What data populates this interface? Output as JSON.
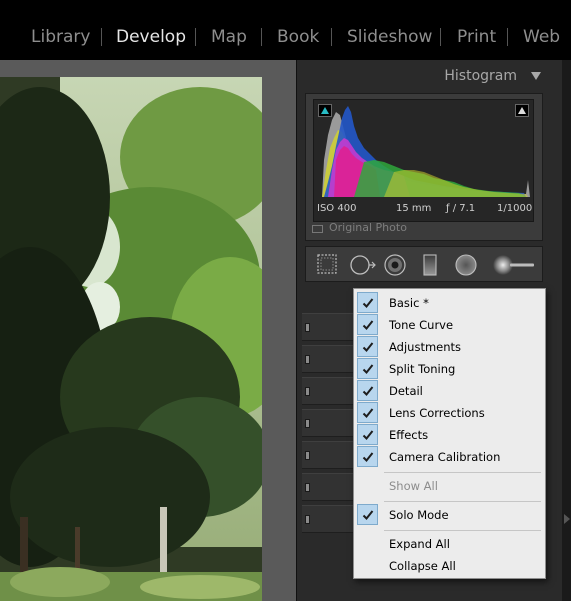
{
  "module_picker": {
    "modules": [
      {
        "label": "Library",
        "active": false
      },
      {
        "label": "Develop",
        "active": true
      },
      {
        "label": "Map",
        "active": false
      },
      {
        "label": "Book",
        "active": false
      },
      {
        "label": "Slideshow",
        "active": false
      },
      {
        "label": "Print",
        "active": false
      },
      {
        "label": "Web",
        "active": false
      }
    ]
  },
  "histogram": {
    "title": "Histogram",
    "exif": {
      "iso": "ISO 400",
      "focal_length": "15 mm",
      "aperture": "ƒ / 7.1",
      "shutter": "1/1000"
    },
    "original_photo_label": "Original Photo",
    "colors": {
      "shadow_clip": "#28bcc5",
      "highlight_clip": "#dddddd"
    }
  },
  "tool_strip": {
    "tools": [
      {
        "icon": "crop-overlay-icon"
      },
      {
        "icon": "spot-removal-icon"
      },
      {
        "icon": "red-eye-correction-icon"
      },
      {
        "icon": "graduated-filter-icon"
      },
      {
        "icon": "radial-filter-icon"
      },
      {
        "icon": "adjustment-brush-icon"
      }
    ]
  },
  "panel_menu": {
    "panels": [
      {
        "label": "Basic *",
        "checked": true
      },
      {
        "label": "Tone Curve",
        "checked": true
      },
      {
        "label": "Adjustments",
        "checked": true
      },
      {
        "label": "Split Toning",
        "checked": true
      },
      {
        "label": "Detail",
        "checked": true
      },
      {
        "label": "Lens Corrections",
        "checked": true
      },
      {
        "label": "Effects",
        "checked": true
      },
      {
        "label": "Camera Calibration",
        "checked": true
      }
    ],
    "show_all": {
      "label": "Show All",
      "enabled": false
    },
    "solo_mode": {
      "label": "Solo Mode",
      "checked": true
    },
    "expand_all": "Expand All",
    "collapse_all": "Collapse All",
    "colors": {
      "check_highlight": "#b8d6ee",
      "menu_background": "#ececec"
    }
  }
}
